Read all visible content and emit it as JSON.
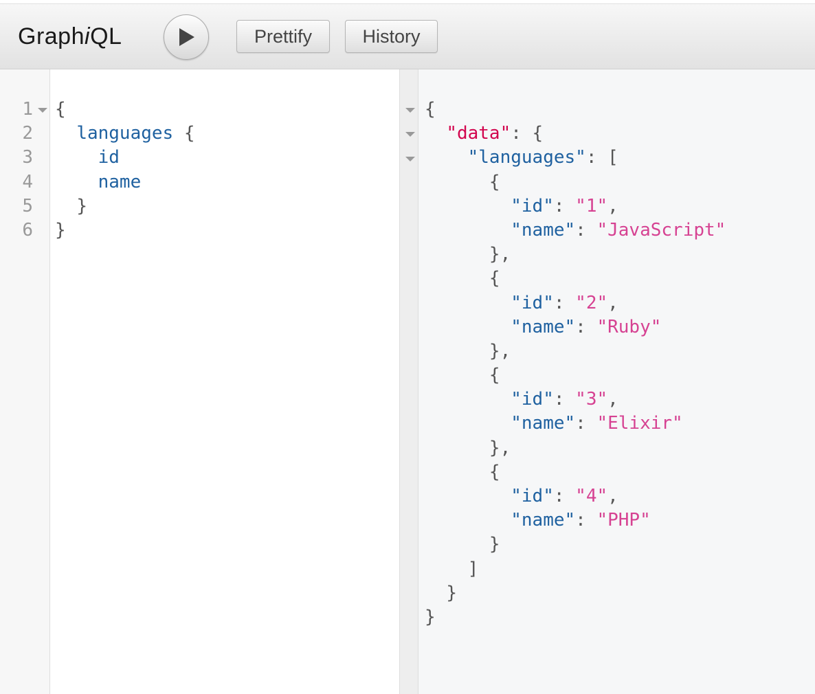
{
  "header": {
    "title_pre": "Graph",
    "title_i": "i",
    "title_post": "QL",
    "execute_icon": "play-icon",
    "prettify_label": "Prettify",
    "history_label": "History"
  },
  "query_editor": {
    "line_numbers": [
      "1",
      "2",
      "3",
      "4",
      "5",
      "6"
    ],
    "lines": [
      {
        "indent": "",
        "field": "",
        "punc": "{"
      },
      {
        "indent": "  ",
        "field": "languages",
        "punc": " {"
      },
      {
        "indent": "    ",
        "field": "id",
        "punc": ""
      },
      {
        "indent": "    ",
        "field": "name",
        "punc": ""
      },
      {
        "indent": "  ",
        "field": "",
        "punc": "}"
      },
      {
        "indent": "",
        "field": "",
        "punc": "}"
      }
    ]
  },
  "result_viewer": {
    "lines": [
      {
        "indent": "",
        "parts": [
          {
            "t": "{",
            "c": "punc"
          }
        ]
      },
      {
        "indent": "  ",
        "parts": [
          {
            "t": "\"data\"",
            "c": "datakey"
          },
          {
            "t": ": {",
            "c": "punc"
          }
        ]
      },
      {
        "indent": "    ",
        "parts": [
          {
            "t": "\"languages\"",
            "c": "key"
          },
          {
            "t": ": [",
            "c": "punc"
          }
        ]
      },
      {
        "indent": "      ",
        "parts": [
          {
            "t": "{",
            "c": "punc"
          }
        ]
      },
      {
        "indent": "        ",
        "parts": [
          {
            "t": "\"id\"",
            "c": "key"
          },
          {
            "t": ": ",
            "c": "punc"
          },
          {
            "t": "\"1\"",
            "c": "str"
          },
          {
            "t": ",",
            "c": "punc"
          }
        ]
      },
      {
        "indent": "        ",
        "parts": [
          {
            "t": "\"name\"",
            "c": "key"
          },
          {
            "t": ": ",
            "c": "punc"
          },
          {
            "t": "\"JavaScript\"",
            "c": "str"
          }
        ]
      },
      {
        "indent": "      ",
        "parts": [
          {
            "t": "},",
            "c": "punc"
          }
        ]
      },
      {
        "indent": "      ",
        "parts": [
          {
            "t": "{",
            "c": "punc"
          }
        ]
      },
      {
        "indent": "        ",
        "parts": [
          {
            "t": "\"id\"",
            "c": "key"
          },
          {
            "t": ": ",
            "c": "punc"
          },
          {
            "t": "\"2\"",
            "c": "str"
          },
          {
            "t": ",",
            "c": "punc"
          }
        ]
      },
      {
        "indent": "        ",
        "parts": [
          {
            "t": "\"name\"",
            "c": "key"
          },
          {
            "t": ": ",
            "c": "punc"
          },
          {
            "t": "\"Ruby\"",
            "c": "str"
          }
        ]
      },
      {
        "indent": "      ",
        "parts": [
          {
            "t": "},",
            "c": "punc"
          }
        ]
      },
      {
        "indent": "      ",
        "parts": [
          {
            "t": "{",
            "c": "punc"
          }
        ]
      },
      {
        "indent": "        ",
        "parts": [
          {
            "t": "\"id\"",
            "c": "key"
          },
          {
            "t": ": ",
            "c": "punc"
          },
          {
            "t": "\"3\"",
            "c": "str"
          },
          {
            "t": ",",
            "c": "punc"
          }
        ]
      },
      {
        "indent": "        ",
        "parts": [
          {
            "t": "\"name\"",
            "c": "key"
          },
          {
            "t": ": ",
            "c": "punc"
          },
          {
            "t": "\"Elixir\"",
            "c": "str"
          }
        ]
      },
      {
        "indent": "      ",
        "parts": [
          {
            "t": "},",
            "c": "punc"
          }
        ]
      },
      {
        "indent": "      ",
        "parts": [
          {
            "t": "{",
            "c": "punc"
          }
        ]
      },
      {
        "indent": "        ",
        "parts": [
          {
            "t": "\"id\"",
            "c": "key"
          },
          {
            "t": ": ",
            "c": "punc"
          },
          {
            "t": "\"4\"",
            "c": "str"
          },
          {
            "t": ",",
            "c": "punc"
          }
        ]
      },
      {
        "indent": "        ",
        "parts": [
          {
            "t": "\"name\"",
            "c": "key"
          },
          {
            "t": ": ",
            "c": "punc"
          },
          {
            "t": "\"PHP\"",
            "c": "str"
          }
        ]
      },
      {
        "indent": "      ",
        "parts": [
          {
            "t": "}",
            "c": "punc"
          }
        ]
      },
      {
        "indent": "    ",
        "parts": [
          {
            "t": "]",
            "c": "punc"
          }
        ]
      },
      {
        "indent": "  ",
        "parts": [
          {
            "t": "}",
            "c": "punc"
          }
        ]
      },
      {
        "indent": "",
        "parts": [
          {
            "t": "}",
            "c": "punc"
          }
        ]
      }
    ]
  },
  "colors": {
    "field": "#1f61a0",
    "data_key": "#d2054e",
    "string": "#d64292",
    "punctuation": "#555555"
  }
}
